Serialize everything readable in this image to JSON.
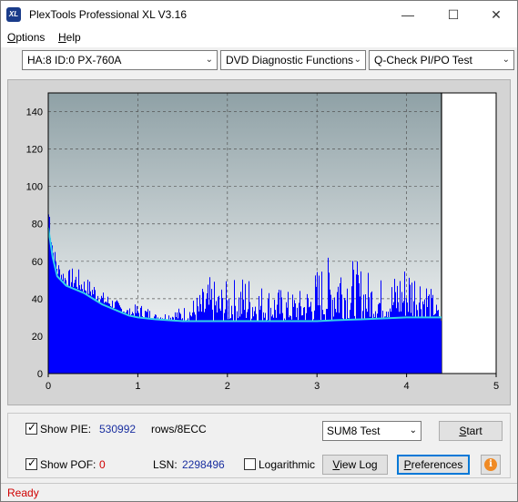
{
  "window": {
    "title": "PlexTools Professional XL V3.16",
    "icon_label": "XL",
    "minimize_glyph": "—",
    "maximize_glyph": "☐",
    "close_glyph": "✕"
  },
  "menu": {
    "options": {
      "accel": "O",
      "rest": "ptions"
    },
    "help": {
      "accel": "H",
      "rest": "elp"
    }
  },
  "toolbar": {
    "drive": "HA:8 ID:0  PX-760A",
    "function": "DVD Diagnostic Functions",
    "test": "Q-Check PI/PO Test"
  },
  "chart_data": {
    "type": "area",
    "y_ticks": [
      "0",
      "20",
      "40",
      "60",
      "80",
      "100",
      "120",
      "140"
    ],
    "x_ticks": [
      "0",
      "1",
      "2",
      "3",
      "4",
      "5"
    ],
    "xlim": [
      0,
      5
    ],
    "ylim": [
      0,
      150
    ],
    "grid": true,
    "end_of_data_x": 4.39,
    "series": [
      {
        "kind": "bar-envelope",
        "color": "#0000ff",
        "x": [
          0.0,
          0.02,
          0.05,
          0.1,
          0.15,
          0.2,
          0.3,
          0.4,
          0.5,
          0.55,
          0.6,
          0.7,
          0.8,
          0.9,
          1.0,
          1.1,
          1.2,
          1.3,
          1.4,
          1.5,
          1.6,
          1.7,
          1.8,
          1.9,
          2.0,
          2.1,
          2.2,
          2.3,
          2.4,
          2.5,
          2.6,
          2.7,
          2.8,
          2.9,
          3.0,
          3.1,
          3.2,
          3.25,
          3.3,
          3.4,
          3.5,
          3.6,
          3.7,
          3.8,
          3.9,
          4.0,
          4.1,
          4.2,
          4.3,
          4.35,
          4.39
        ],
        "values": [
          100,
          95,
          70,
          62,
          58,
          55,
          58,
          52,
          50,
          49,
          44,
          42,
          38,
          35,
          38,
          36,
          32,
          33,
          35,
          36,
          40,
          45,
          52,
          48,
          50,
          52,
          55,
          51,
          48,
          47,
          46,
          44,
          45,
          48,
          58,
          62,
          68,
          75,
          66,
          62,
          58,
          55,
          52,
          50,
          58,
          62,
          60,
          55,
          42,
          35,
          25
        ]
      },
      {
        "kind": "line",
        "color": "#35d0e8",
        "x": [
          0.0,
          0.05,
          0.1,
          0.2,
          0.3,
          0.4,
          0.5,
          0.6,
          0.7,
          0.8,
          0.9,
          1.0,
          1.2,
          1.5,
          2.0,
          2.5,
          3.0,
          3.2,
          3.5,
          4.0,
          4.2,
          4.39
        ],
        "values": [
          78,
          62,
          52,
          47,
          45,
          43,
          40,
          37,
          35,
          33,
          31,
          30,
          29,
          28,
          28,
          28,
          28,
          28.5,
          29,
          30,
          30,
          30
        ]
      }
    ]
  },
  "controls": {
    "show_pie_label": "Show PIE:",
    "show_pie_value": "530992",
    "show_pie_checked": "✓",
    "rows_label": "rows/8ECC",
    "show_pof_label": "Show POF:",
    "show_pof_value": "0",
    "show_pof_checked": "✓",
    "lsn_label": "LSN:",
    "lsn_value": "2298496",
    "logarithmic_label": "Logarithmic",
    "sum_select": "SUM8 Test",
    "start": {
      "accel": "S",
      "rest": "tart"
    },
    "view_log": {
      "accel": "V",
      "rest": "iew Log"
    },
    "preferences": {
      "accel": "P",
      "rest": "references"
    },
    "info_glyph": "i",
    "arrow_glyph": "⌄"
  },
  "status": {
    "text": "Ready"
  }
}
